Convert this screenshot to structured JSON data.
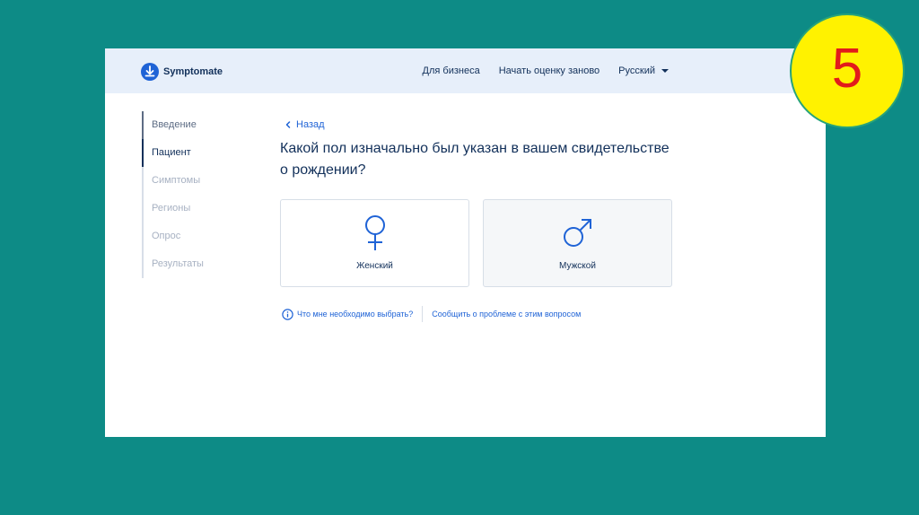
{
  "app": {
    "name": "Symptomate"
  },
  "nav": {
    "business": "Для бизнеса",
    "restart": "Начать оценку заново",
    "language": "Русский"
  },
  "steps": [
    {
      "label": "Введение",
      "state": "done"
    },
    {
      "label": "Пациент",
      "state": "active"
    },
    {
      "label": "Симптомы",
      "state": "pending"
    },
    {
      "label": "Регионы",
      "state": "pending"
    },
    {
      "label": "Опрос",
      "state": "pending"
    },
    {
      "label": "Результаты",
      "state": "pending"
    }
  ],
  "main": {
    "back": "Назад",
    "question": "Какой пол изначально был указан в вашем свидетельстве о рождении?",
    "options": [
      {
        "label": "Женский",
        "icon": "female-icon"
      },
      {
        "label": "Мужской",
        "icon": "male-icon"
      }
    ],
    "help_link": "Что мне необходимо выбрать?",
    "report_link": "Сообщить о проблеме с этим вопросом"
  },
  "badge": {
    "number": "5"
  },
  "colors": {
    "background": "#0d8b86",
    "topbar": "#e7effa",
    "accent": "#1f63d6",
    "text": "#12305a",
    "badge_fill": "#fff200",
    "badge_text": "#e21b1b"
  }
}
